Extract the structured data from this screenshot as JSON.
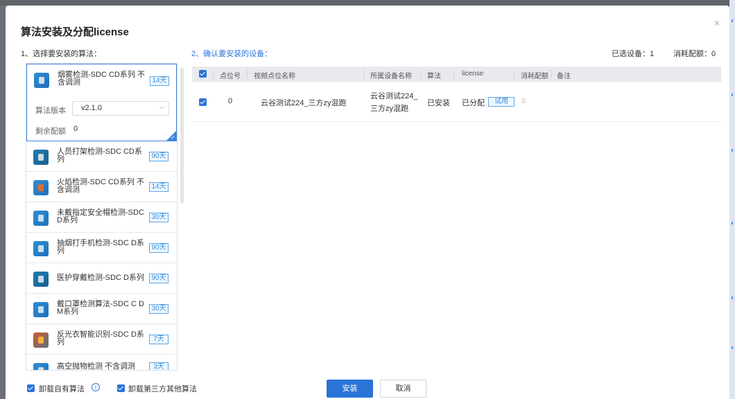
{
  "dialog": {
    "title": "算法安装及分配license",
    "close_glyph": "×"
  },
  "step1": {
    "label": "1、选择要安装的算法："
  },
  "step2": {
    "label": "2、确认要安装的设备：",
    "selected_devices": "已选设备：1",
    "consumed_quota": "消耗配额：0"
  },
  "expanded_algo": {
    "name": "烟雾检测-SDC CD系列 不含调测",
    "days": "14天",
    "version_label": "算法版本",
    "version_value": "v2.1.0",
    "remaining_label": "剩余配额",
    "remaining_value": "0"
  },
  "algorithms": [
    {
      "name": "人员打架检测-SDC CD系列",
      "days": "90天"
    },
    {
      "name": "火焰检测-SDC CD系列 不含调测",
      "days": "14天"
    },
    {
      "name": "未戴指定安全帽检测-SDC D系列",
      "days": "30天"
    },
    {
      "name": "抽烟打手机检测-SDC D系列",
      "days": "90天"
    },
    {
      "name": "医护穿戴检测-SDC D系列",
      "days": "90天"
    },
    {
      "name": "戴口罩检测算法-SDC C D M系列",
      "days": "30天"
    },
    {
      "name": "反光衣智能识别-SDC D系列",
      "days": "7天"
    },
    {
      "name": "高空抛物检测 不含调测",
      "days": "3天"
    }
  ],
  "table": {
    "headers": {
      "point_no": "点位号",
      "point_name": "视频点位名称",
      "device_name": "所属设备名称",
      "algorithm": "算法",
      "license": "license",
      "quota": "消耗配额",
      "remark": "备注"
    },
    "rows": [
      {
        "point_no": "0",
        "point_name": "云谷测试224_三方zy混跑",
        "device_name_line1": "云谷测试224_",
        "device_name_line2": "三方zy混跑",
        "algorithm": "已安装",
        "license": "已分配",
        "license_badge": "试用",
        "quota": "0"
      }
    ]
  },
  "footer": {
    "uninstall_own": "卸载自有算法",
    "uninstall_third": "卸载第三方其他算法",
    "info_glyph": "i",
    "install_label": "安装",
    "cancel_label": "取消"
  },
  "colors": {
    "primary": "#2a74d8",
    "badge_border": "#5aa7e8",
    "header_bg": "#e8eaed"
  }
}
